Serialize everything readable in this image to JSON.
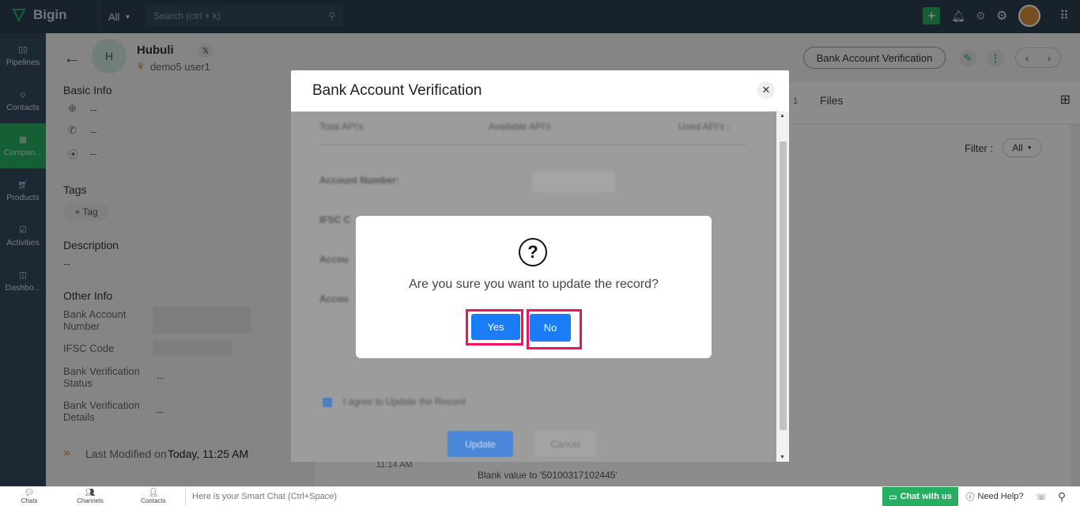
{
  "topbar": {
    "app_name": "Bigin",
    "all_label": "All",
    "search_placeholder": "Search (ctrl + k)"
  },
  "sidebar": {
    "items": [
      {
        "label": "Pipelines",
        "icon": "pipelines-icon"
      },
      {
        "label": "Contacts",
        "icon": "contacts-icon"
      },
      {
        "label": "Compan...",
        "icon": "companies-icon",
        "active": true
      },
      {
        "label": "Products",
        "icon": "products-icon"
      },
      {
        "label": "Activities",
        "icon": "activities-icon"
      },
      {
        "label": "Dashbo...",
        "icon": "dashboards-icon"
      }
    ]
  },
  "record": {
    "avatar": "H",
    "name": "Hubuli",
    "owner": "demo5 user1",
    "bank_btn": "Bank Account Verification"
  },
  "left": {
    "basic_info": "Basic Info",
    "dash": "--",
    "tags": "Tags",
    "tag_btn": "Tag",
    "description": "Description",
    "desc_value": "--",
    "other_info": "Other Info",
    "bank_account_number": "Bank Account Number",
    "ifsc_code": "IFSC Code",
    "bank_verification_status": "Bank Verification Status",
    "bank_verification_details": "Bank Verification Details",
    "last_modified_prefix": "Last Modified on",
    "last_modified_value": "Today, 11:25 AM"
  },
  "right": {
    "tab_files": "Files",
    "tab_count": "1",
    "filter_label": "Filter :",
    "filter_value": "All",
    "timeline_time": "11:14 AM",
    "timeline_text": "Blank value to '50100317102445'"
  },
  "modal": {
    "title": "Bank Account Verification",
    "total_apis": "Total API's",
    "available_apis": "Available API's",
    "used_apis": "Used API's :",
    "account_number": "Account Number:",
    "ifsc": "IFSC C",
    "accou1": "Accou",
    "accou2": "Accou",
    "agree": "I agree to Update the Record",
    "update": "Update",
    "cancel": "Cancel"
  },
  "confirm": {
    "message": "Are you sure you want to update the record?",
    "yes": "Yes",
    "no": "No"
  },
  "bottombar": {
    "chats": "Chats",
    "channels": "Channels",
    "contacts": "Contacts",
    "smart_chat": "Here is your Smart Chat (Ctrl+Space)",
    "chat_with_us": "Chat with us",
    "need_help": "Need Help?"
  }
}
